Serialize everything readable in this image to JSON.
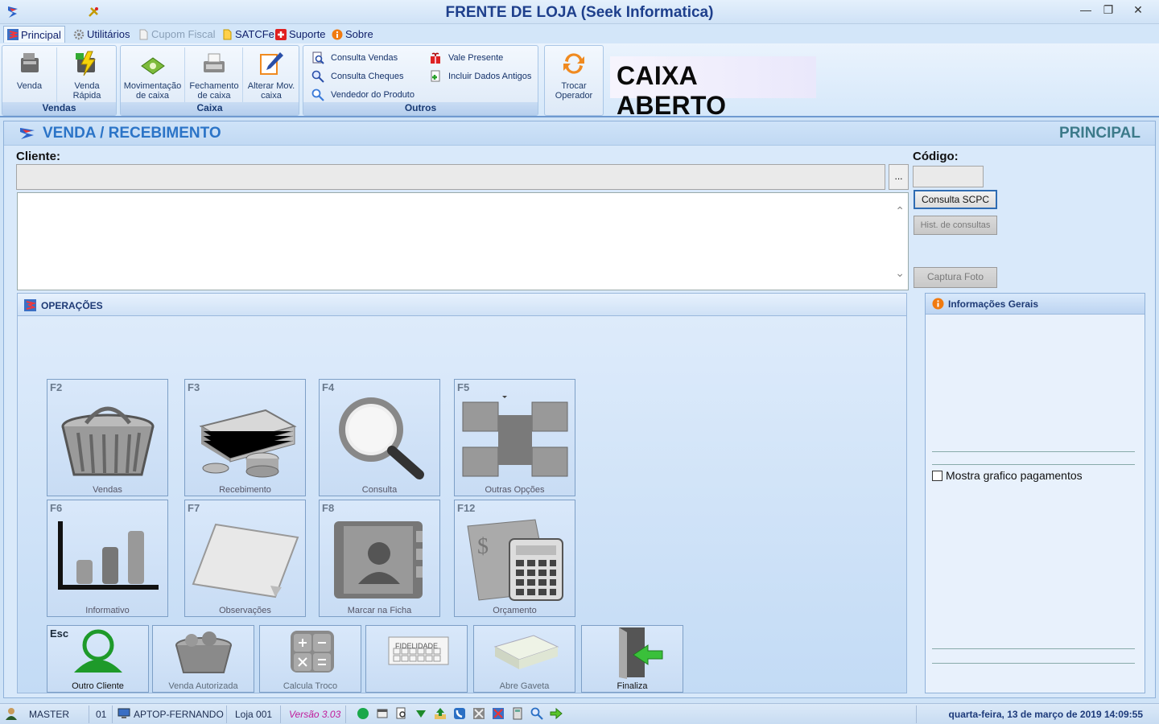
{
  "window": {
    "title": "FRENTE DE LOJA (Seek Informatica)",
    "minimize": "—",
    "restore": "❐",
    "close": "✕"
  },
  "menu": {
    "items": [
      {
        "label": "Principal"
      },
      {
        "label": "Utilitários"
      },
      {
        "label": "Cupom Fiscal"
      },
      {
        "label": "SATCFe"
      },
      {
        "label": "Suporte"
      },
      {
        "label": "Sobre"
      }
    ]
  },
  "ribbon": {
    "vendas": {
      "group_label": "Vendas",
      "venda": "Venda",
      "venda_rapida_1": "Venda",
      "venda_rapida_2": "Rápida"
    },
    "caixa": {
      "group_label": "Caixa",
      "movimentacao_1": "Movimentação",
      "movimentacao_2": "de caixa",
      "fechamento_1": "Fechamento",
      "fechamento_2": "de caixa",
      "alterar_1": "Alterar Mov.",
      "alterar_2": "caixa"
    },
    "outros": {
      "group_label": "Outros",
      "consulta_vendas": "Consulta Vendas",
      "consulta_cheques": "Consulta Cheques",
      "vendedor_produto": "Vendedor do Produto",
      "vale_presente": "Vale Presente",
      "incluir_dados": "Incluir Dados Antigos"
    },
    "trocar_1": "Trocar",
    "trocar_2": "Operador",
    "status_banner": "CAIXA ABERTO"
  },
  "page": {
    "title": "VENDA / RECEBIMENTO",
    "section": "PRINCIPAL",
    "cliente_label": "Cliente:",
    "cliente_value": "",
    "dots": "...",
    "codigo_label": "Código:",
    "codigo_value": "",
    "consulta_scpc": "Consulta SCPC",
    "hist_consultas": "Hist. de consultas",
    "captura_foto": "Captura Foto"
  },
  "operations": {
    "title": "OPERAÇÕES",
    "tiles": [
      {
        "key": "F2",
        "label": "Vendas"
      },
      {
        "key": "F3",
        "label": "Recebimento"
      },
      {
        "key": "F4",
        "label": "Consulta"
      },
      {
        "key": "F5",
        "label": "Outras Opções"
      },
      {
        "key": "F6",
        "label": "Informativo"
      },
      {
        "key": "F7",
        "label": "Observações"
      },
      {
        "key": "F8",
        "label": "Marcar na Ficha"
      },
      {
        "key": "F12",
        "label": "Orçamento"
      }
    ],
    "bottom": [
      {
        "key": "Esc",
        "label": "Outro Cliente"
      },
      {
        "key": "",
        "label": "Venda Autorizada"
      },
      {
        "key": "",
        "label": "Calcula Troco"
      },
      {
        "key": "",
        "label": "FIDELIDADE"
      },
      {
        "key": "",
        "label": "Abre Gaveta"
      },
      {
        "key": "",
        "label": "Finaliza"
      }
    ]
  },
  "info": {
    "title": "Informações Gerais",
    "checkbox_label": "Mostra grafico pagamentos",
    "checked": false
  },
  "status": {
    "user": "MASTER",
    "terminal": "01",
    "machine": "APTOP-FERNANDO",
    "loja": "Loja 001",
    "versao": "Versão 3.03",
    "datetime": "quarta-feira, 13 de março de 2019 14:09:55"
  },
  "colors": {
    "accent": "#2b74c7",
    "title_blue": "#1e3f8c",
    "version_magenta": "#c01a9a"
  }
}
